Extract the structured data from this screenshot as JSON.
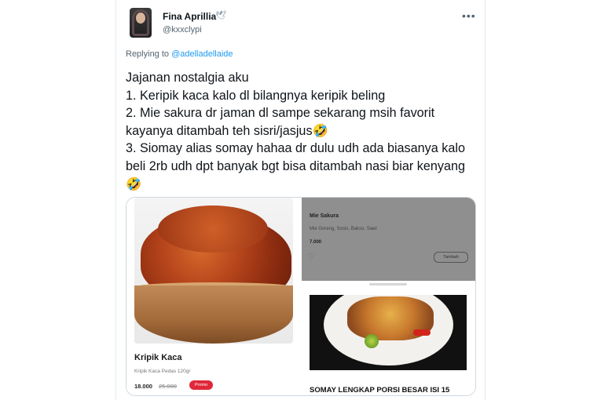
{
  "tweet": {
    "display_name": "Fina Aprillia",
    "verified_symbol": "🕊",
    "handle": "@kxxclypi",
    "more": "•••",
    "replying_to_prefix": "Replying to ",
    "replying_to_user": "@adelladellaide",
    "text": "Jajanan nostalgia aku\n1. Keripik kaca kalo dl bilangnya keripik beling\n2. Mie sakura dr jaman dl sampe sekarang msih favorit kayanya ditambah teh sisri/jasjus🤣\n3. Siomay alias somay hahaa dr dulu udh ada biasanya kalo beli 2rb udh dpt banyak bgt bisa ditambah nasi biar kenyang🤣"
  },
  "media": {
    "left_card": {
      "title": "Kripik Kaca",
      "subtitle": "Kripik Kaca Pedas 120gr",
      "price": "18.000",
      "old_price": "25.000",
      "badge": "Promo"
    },
    "right_top_card": {
      "title": "Mie Sakura",
      "subtitle": "Mie Goreng, Sosis, Bakso, Sawi",
      "price": "7.000",
      "icon": "heart-icon",
      "button": "Tambah"
    },
    "right_bottom_card": {
      "title": "SOMAY LENGKAP PORSI BESAR ISI 15"
    }
  },
  "colors": {
    "link": "#1d9bf0",
    "promo": "#e0283a"
  }
}
